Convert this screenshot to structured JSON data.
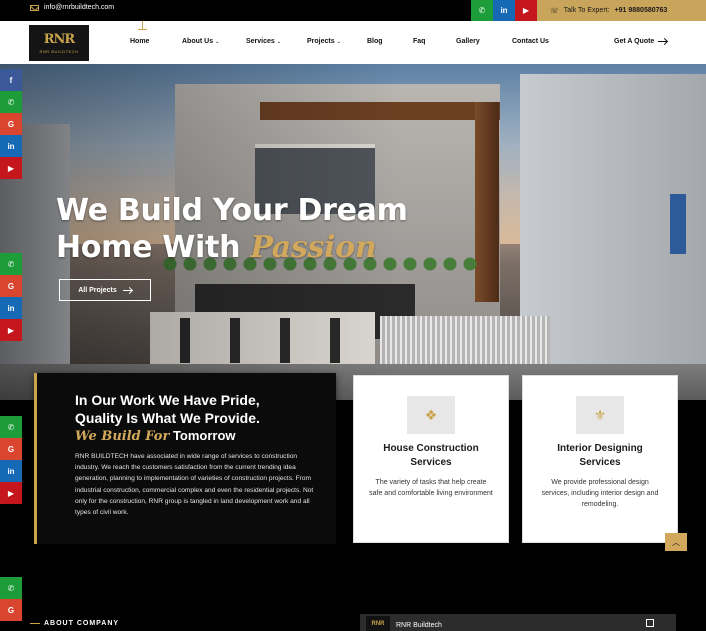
{
  "topbar": {
    "email": "info@rnrbuildtech.com",
    "social": [
      {
        "icon": "whatsapp-icon",
        "glyph": "✆"
      },
      {
        "icon": "linkedin-icon",
        "glyph": "in"
      },
      {
        "icon": "youtube-icon",
        "glyph": "▶"
      }
    ],
    "expert_label": "Talk To Expert:",
    "expert_phone": "+91 9880580763"
  },
  "brand": {
    "logo_mark": "RNR",
    "logo_name": "RNR BUILDTECH"
  },
  "nav": {
    "items": [
      {
        "label": "Home"
      },
      {
        "label": "About Us"
      },
      {
        "label": "Services"
      },
      {
        "label": "Projects"
      },
      {
        "label": "Blog"
      },
      {
        "label": "Faq"
      },
      {
        "label": "Gallery"
      },
      {
        "label": "Contact Us"
      }
    ],
    "cta": "Get A Quote"
  },
  "hero": {
    "line1": "We Build Your Dream",
    "line2": "Home With",
    "accent": "Passion",
    "button": "All Projects"
  },
  "side_social": {
    "group1": [
      {
        "icon": "facebook-icon",
        "glyph": "f"
      },
      {
        "icon": "whatsapp-icon",
        "glyph": "✆"
      },
      {
        "icon": "google-icon",
        "glyph": "G"
      },
      {
        "icon": "linkedin-icon",
        "glyph": "in"
      },
      {
        "icon": "youtube-icon",
        "glyph": "▶"
      }
    ],
    "group2": [
      {
        "icon": "whatsapp-icon",
        "glyph": "✆"
      },
      {
        "icon": "google-icon",
        "glyph": "G"
      },
      {
        "icon": "linkedin-icon",
        "glyph": "in"
      },
      {
        "icon": "youtube-icon",
        "glyph": "▶"
      }
    ],
    "group3": [
      {
        "icon": "whatsapp-icon",
        "glyph": "✆"
      },
      {
        "icon": "google-icon",
        "glyph": "G"
      },
      {
        "icon": "linkedin-icon",
        "glyph": "in"
      },
      {
        "icon": "youtube-icon",
        "glyph": "▶"
      }
    ],
    "group4": [
      {
        "icon": "whatsapp-icon",
        "glyph": "✆"
      },
      {
        "icon": "google-icon",
        "glyph": "G"
      }
    ]
  },
  "pride": {
    "line1": "In Our Work We Have Pride,",
    "line2": "Quality Is What We Provide.",
    "tag_accent": "We Build For",
    "tag_rest": "Tomorrow",
    "body": "RNR BUILDTECH have associated in wide range of services to construction industry. We reach the customers satisfaction from the current trending idea generation, planning to implementation of varieties of construction projects. From industrial construction, commercial complex and even the residential projects. Not only for the construction, RNR group is tangled in land development work and all types of civil work."
  },
  "services": [
    {
      "title": "House Construction Services",
      "desc": "The variety of tasks that help create safe and comfortable living environment",
      "icon": "house-construction-icon"
    },
    {
      "title": "Interior Designing Services",
      "desc": "We provide professional design services, including interior design and remodeling.",
      "icon": "interior-design-icon"
    }
  ],
  "about": {
    "label": "ABOUT COMPANY"
  },
  "video": {
    "title": "RNR Buildtech"
  },
  "colors": {
    "gold": "#c9a44c",
    "dark": "#0b0b0b",
    "whatsapp": "#1d9c3a",
    "linkedin": "#1569b5",
    "youtube": "#c4161c",
    "facebook": "#3b5998",
    "google": "#d9452e"
  }
}
